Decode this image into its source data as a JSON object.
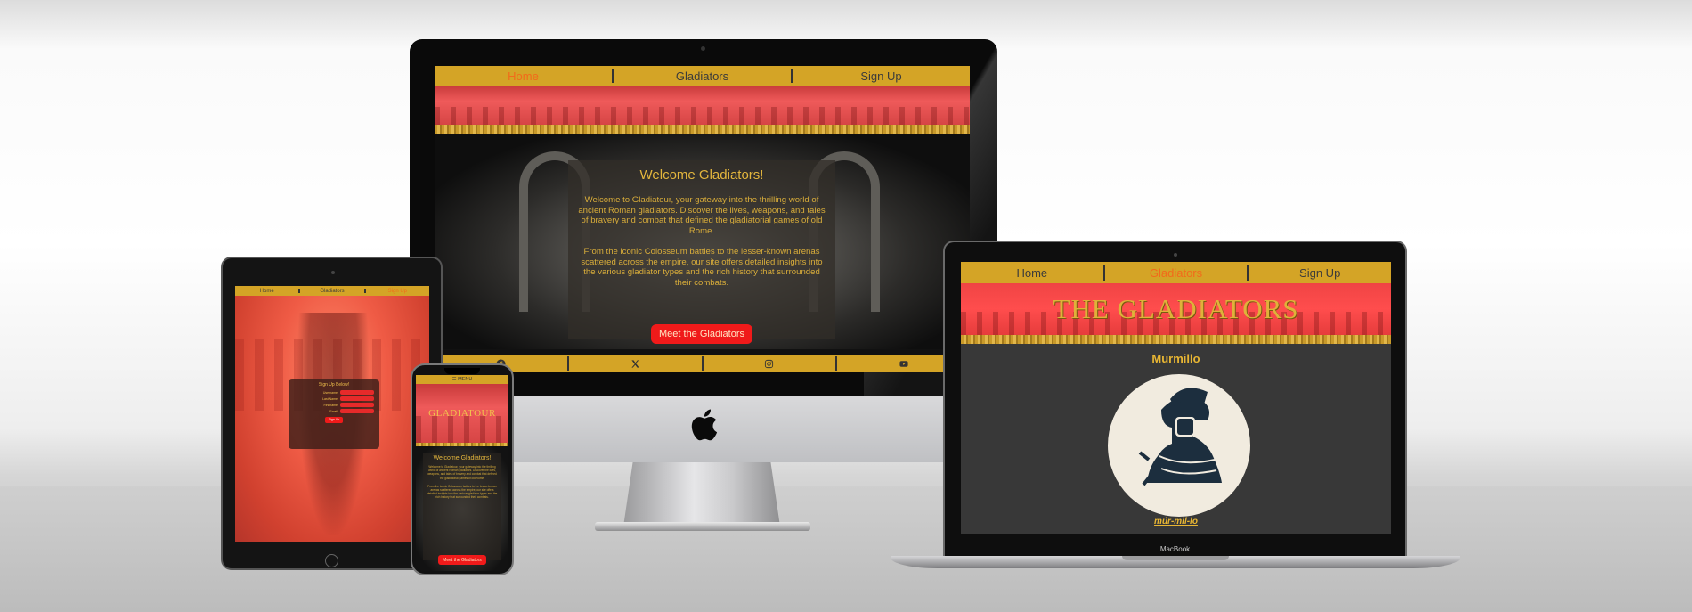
{
  "imac_site": {
    "nav": {
      "home": "Home",
      "gladiators": "Gladiators",
      "signup": "Sign Up",
      "active": "home"
    },
    "welcome": {
      "title": "Welcome Gladiators!",
      "para1": "Welcome to Gladiatour, your gateway into the thrilling world of ancient Roman gladiators. Discover the lives, weapons, and tales of bravery and combat that defined the gladiatorial games of old Rome.",
      "para2": "From the iconic Colosseum battles to the lesser-known arenas scattered across the empire, our site offers detailed insights into the various gladiator types and the rich history that surrounded their combats."
    },
    "cta": "Meet the Gladiators",
    "footer_icons": [
      "facebook-icon",
      "x-icon",
      "instagram-icon",
      "youtube-icon"
    ]
  },
  "tablet_site": {
    "nav": {
      "home": "Home",
      "gladiators": "Gladiators",
      "signup": "Sign Up",
      "active": "signup"
    },
    "form": {
      "title": "Sign Up Below!",
      "fields": [
        "Username",
        "Last Name",
        "Firstname",
        "Email"
      ],
      "submit": "Sign Up"
    }
  },
  "phone_site": {
    "menu": "☰ MENU",
    "title": "GLADIATOUR",
    "welcome_title": "Welcome Gladiators!",
    "para1": "Welcome to Gladiatour, your gateway into the thrilling world of ancient Roman gladiators. Discover the lives, weapons, and tales of bravery and combat that defined the gladiatorial games of old Rome.",
    "para2": "From the iconic Colosseum battles to the lesser-known arenas scattered across the empire, our site offers detailed insights into the various gladiator types and the rich history that surrounded their combats.",
    "cta": "Meet the Gladiators"
  },
  "macbook_site": {
    "nav": {
      "home": "Home",
      "gladiators": "Gladiators",
      "signup": "Sign Up",
      "active": "gladiators"
    },
    "title": "THE GLADIATORS",
    "gladiator_name": "Murmillo",
    "pronunciation": "múr-mil-lo"
  },
  "devices": {
    "macbook_label": "MacBook"
  },
  "colors": {
    "gold": "#d4a426",
    "active_link": "#f26a1b",
    "cta_red": "#f01a1a",
    "banner_red": "#ef5a5a"
  }
}
